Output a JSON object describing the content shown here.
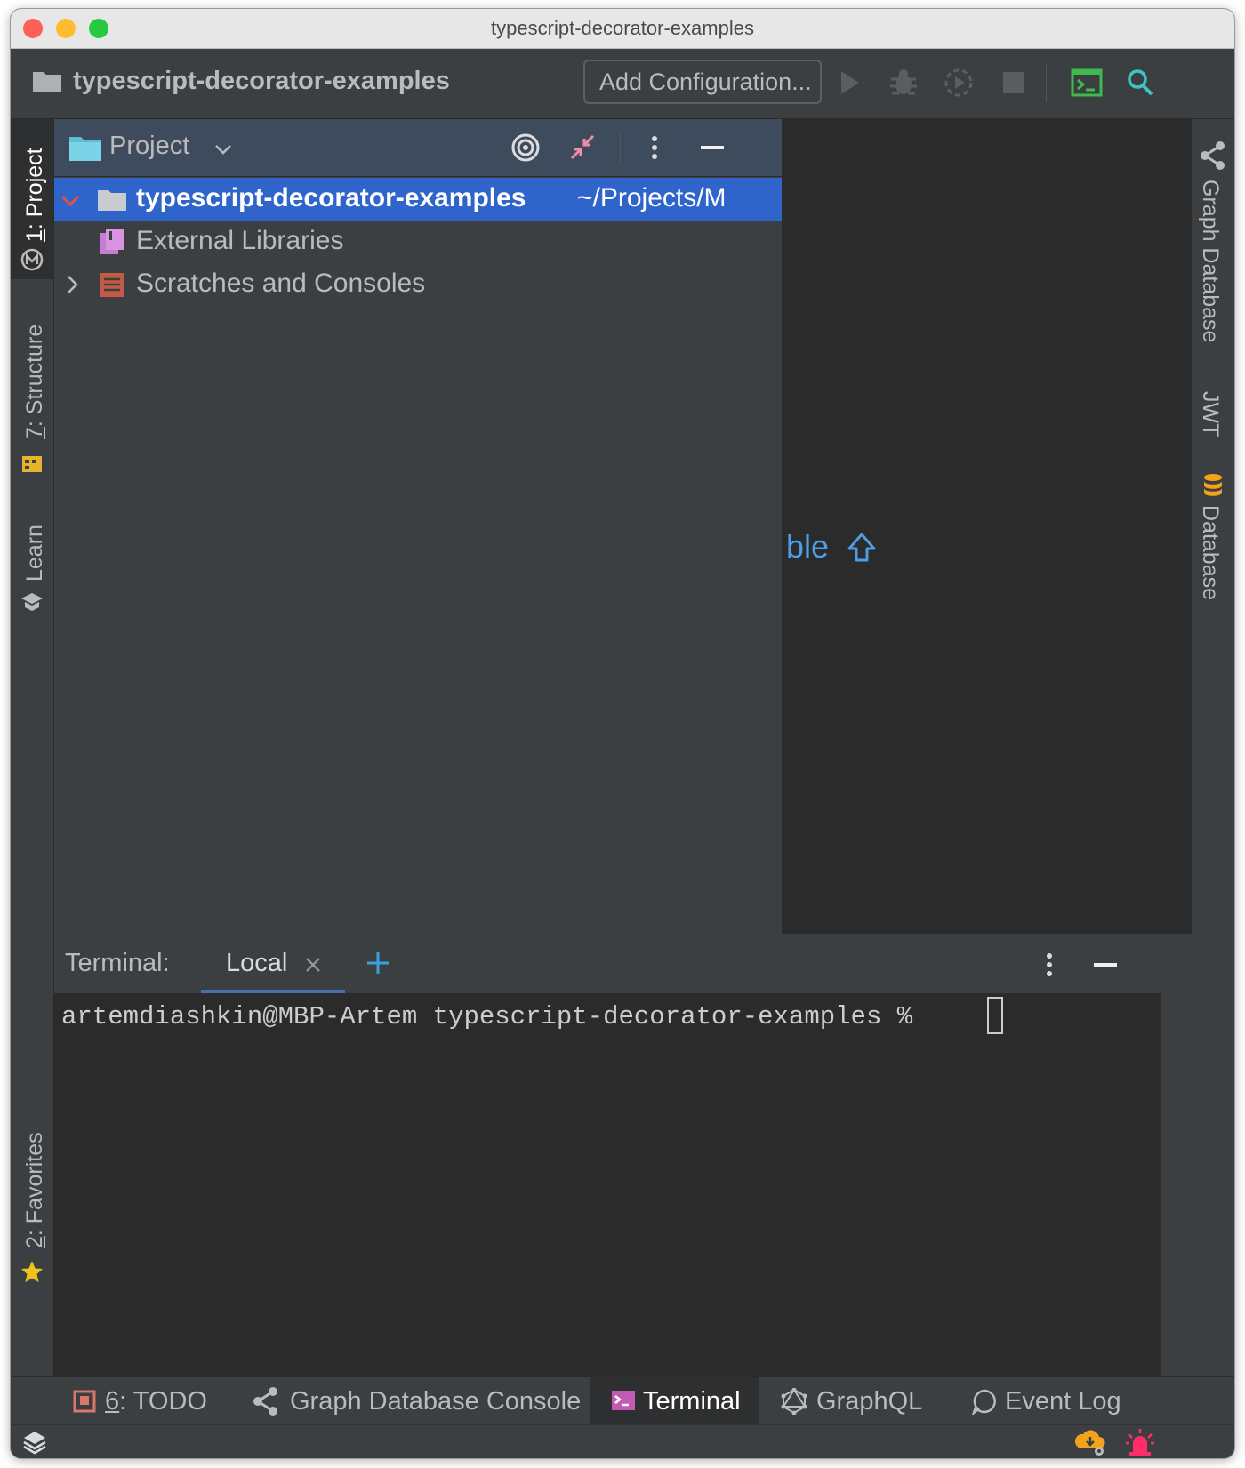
{
  "window": {
    "title": "typescript-decorator-examples"
  },
  "navbar": {
    "project_name": "typescript-decorator-examples",
    "add_configuration": "Add Configuration..."
  },
  "left_tool_windows": [
    {
      "number": "1",
      "label": "Project"
    },
    {
      "number": "7",
      "label": "Structure"
    },
    {
      "label": "Learn"
    },
    {
      "number": "2",
      "label": "Favorites"
    }
  ],
  "right_tool_windows": [
    {
      "label": "Graph Database"
    },
    {
      "label": "JWT"
    },
    {
      "label": "Database"
    }
  ],
  "project_panel": {
    "title": "Project",
    "tree": [
      {
        "label": "typescript-decorator-examples",
        "path": "~/Projects/M",
        "selected": true,
        "expanded": true
      },
      {
        "label": "External Libraries"
      },
      {
        "label": "Scratches and Consoles"
      }
    ]
  },
  "editor": {
    "hint_text": "ble"
  },
  "terminal": {
    "title": "Terminal:",
    "tab": "Local",
    "prompt": "artemdiashkin@MBP-Artem typescript-decorator-examples %"
  },
  "bottom_tabs": [
    {
      "number": "6",
      "label": "TODO"
    },
    {
      "label": "Graph Database Console"
    },
    {
      "label": "Terminal",
      "active": true
    },
    {
      "label": "GraphQL"
    },
    {
      "label": "Event Log"
    }
  ],
  "colors": {
    "accent_selection": "#2f65ca",
    "link_blue": "#4a9fe8",
    "search_teal": "#40c4c0",
    "terminal_green": "#3fb950"
  }
}
